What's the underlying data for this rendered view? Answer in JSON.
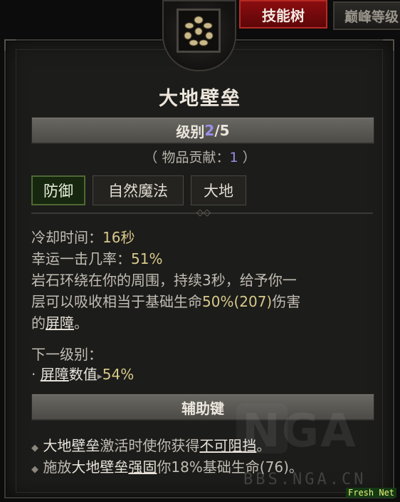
{
  "tabs": {
    "skill_tree": "技能树",
    "paragon": "巅峰等级"
  },
  "skill": {
    "icon": "stone-burst-icon",
    "name": "大地壁垒",
    "rank_label": "级别",
    "rank_current": "2",
    "rank_max": "/5",
    "contrib_prefix": "（ 物品贡献：",
    "contrib_value": "1",
    "contrib_suffix": " ）",
    "tags": [
      "防御",
      "自然魔法",
      "大地"
    ]
  },
  "stats": {
    "cooldown_label": "冷却时间：",
    "cooldown_value": "16秒",
    "lucky_label": "幸运一击几率：",
    "lucky_value": "51%",
    "desc_line1": "岩石环绕在你的周围，持续3秒，给予你一",
    "desc_line2_a": "层可以吸收相当于基础生命",
    "desc_line2_b": "50%(207)",
    "desc_line2_c": "伤害",
    "desc_line3_a": "的",
    "desc_line3_b": "屏障",
    "desc_line3_c": "。"
  },
  "next_rank": {
    "label": "下一级别：",
    "bullet": "·",
    "item_name": "屏障",
    "item_rest": "数值",
    "arrow": "▸",
    "item_value": "54%"
  },
  "modifier": {
    "label": "辅助键",
    "b1_a": "大地壁垒",
    "b1_b": "激活时使你获得",
    "b1_c": "不可阻挡",
    "b1_d": "。",
    "b2_a": "施放",
    "b2_b": "大地壁垒",
    "b2_c": "强固",
    "b2_d": "你18%基础生命(76)。",
    "bullet": "◆"
  },
  "watermark": {
    "nga": "NGA",
    "bbs": "BBS.NGA.CN",
    "badge": "Fresh Net"
  },
  "colors": {
    "accent_red": "#8a0d10",
    "value_gold": "#d8c98a",
    "rank_purple": "#9a8fe8",
    "tag_green": "#4e6a33"
  }
}
